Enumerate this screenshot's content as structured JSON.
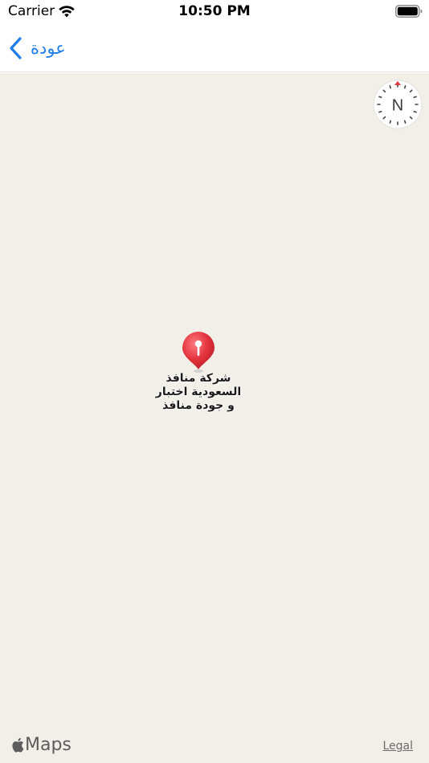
{
  "status_bar": {
    "carrier": "Carrier",
    "time": "10:50 PM",
    "icons": [
      "wifi-icon",
      "battery-icon"
    ]
  },
  "nav_bar": {
    "back_label": "عودة",
    "accent_color": "#1e7ce8"
  },
  "map": {
    "background_color": "#f2efe9",
    "compass_letter": "N",
    "pin_color": "#e3333d",
    "pin_label_lines": [
      "شركة منافذ",
      "السعودية اختبار",
      "و جودة منافذ"
    ],
    "attribution": "Maps",
    "legal_label": "Legal"
  }
}
